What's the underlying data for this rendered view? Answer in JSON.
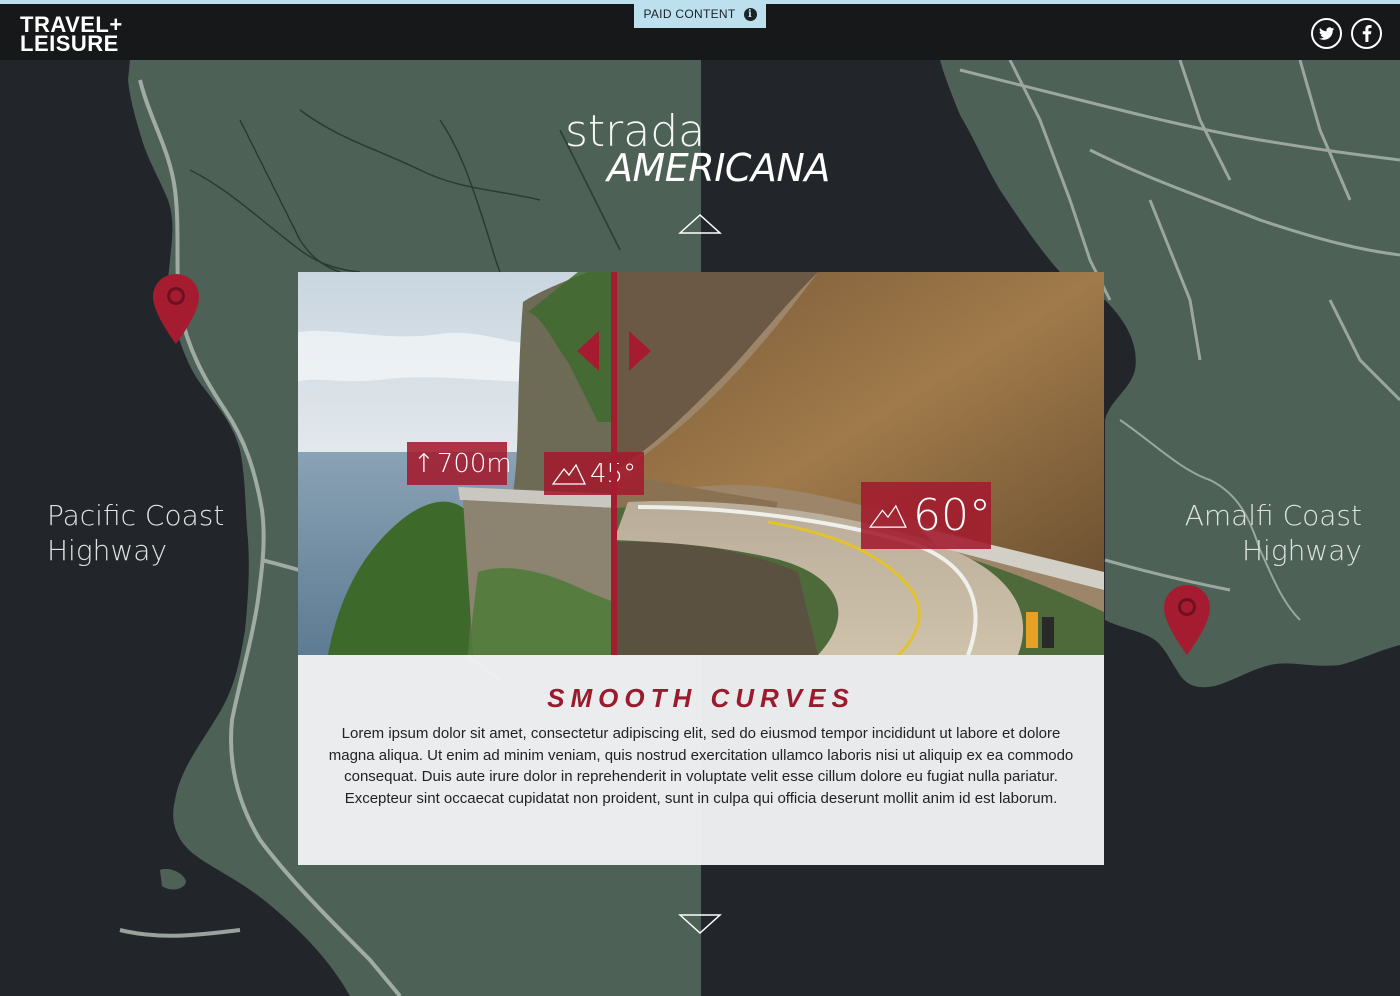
{
  "header": {
    "logo_line1": "TRAVEL+",
    "logo_line2": "LEISURE",
    "paid_label": "PAID CONTENT",
    "info_icon": "i",
    "twitter_icon": "twitter-icon",
    "facebook_icon": "facebook-icon"
  },
  "hero": {
    "title_line1": "strada",
    "title_line2": "AMERICANA"
  },
  "labels": {
    "left_line1": "Pacific Coast",
    "left_line2": "Highway",
    "right_line1": "Amalfi Coast",
    "right_line2": "Highway"
  },
  "badges": {
    "elevation": "700m",
    "angle_left": "45°",
    "angle_right": "60°"
  },
  "card": {
    "title": "SMOOTH CURVES",
    "body": "Lorem ipsum dolor sit amet, consectetur adipiscing elit, sed do eiusmod tempor incididunt ut labore et dolore magna aliqua. Ut enim ad minim veniam, quis nostrud exercitation ullamco laboris nisi ut aliquip ex ea commodo consequat. Duis aute irure dolor in reprehenderit in voluptate velit esse cillum dolore eu fugiat nulla pariatur. Excepteur sint occaecat cupidatat non proident, sunt in culpa qui officia deserunt mollit anim id est laborum."
  },
  "colors": {
    "accent": "#a51c30",
    "map_land": "#4d6157",
    "map_sea": "#22262b",
    "header_bg": "#161819",
    "paid_bg": "#bde0ef"
  }
}
